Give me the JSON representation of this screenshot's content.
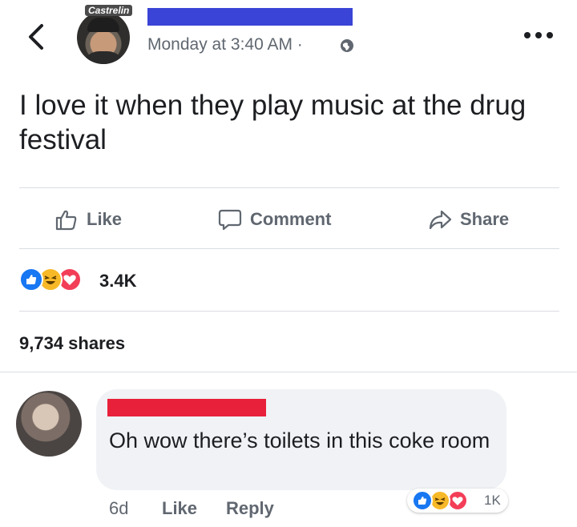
{
  "header": {
    "back_icon": "chevron-left-icon",
    "avatar_brand": "Castrelin",
    "timestamp": "Monday at 3:40 AM ·",
    "privacy_icon": "globe-icon",
    "more_icon": "more-dots-icon"
  },
  "post": {
    "text": "I love it when they play music at the drug festival"
  },
  "actions": {
    "like_label": "Like",
    "comment_label": "Comment",
    "share_label": "Share"
  },
  "reactions": {
    "types": [
      "like",
      "haha",
      "love"
    ],
    "count": "3.4K"
  },
  "shares": {
    "text": "9,734 shares"
  },
  "comment": {
    "text": "Oh wow there’s toilets in this coke room",
    "age": "6d",
    "like_label": "Like",
    "reply_label": "Reply",
    "reaction_count": "1K"
  },
  "colors": {
    "redaction_blue": "#3a44d6",
    "redaction_red": "#e8203a",
    "meta_gray": "#606770",
    "like_blue": "#1877f2",
    "love_red": "#f33e58",
    "haha_yellow": "#f7b928"
  }
}
